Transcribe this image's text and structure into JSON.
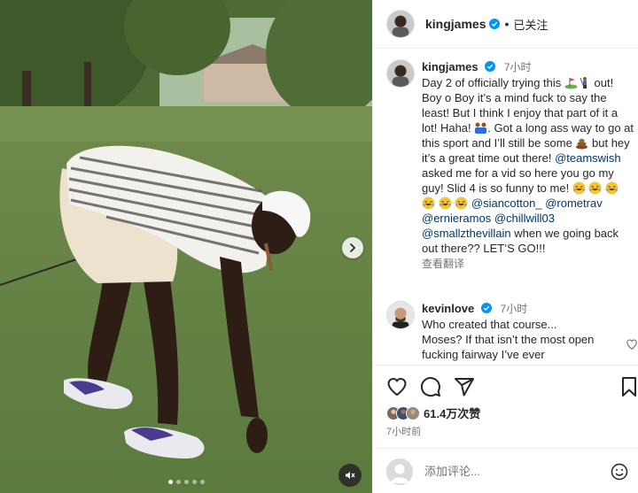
{
  "post": {
    "author": "kingjames",
    "follow_status": "已关注",
    "caption_time": "7小时",
    "caption_parts": {
      "p1": "Day 2 of officially trying this ",
      "p2": " out! Boy o Boy it’s a mind fuck to say the least! But I think I enjoy that part of it a lot! Haha! ",
      "p3": ". Got a long ass way to go at this sport and I’ll still be some ",
      "p4": " but hey it’s a great time out there! ",
      "m1": "@teamswish",
      "p5": " asked me for a vid so here you go my guy! Slid 4 is so funny to me! ",
      "m2": "@siancotton_",
      "m3": "@rometrav",
      "m4": "@ernieramos",
      "m5": "@chillwill03",
      "m6": "@smallzthevillain",
      "p6": " when we going back out there?? LET’S GO!!!"
    },
    "see_translation": "查看翻译"
  },
  "comment": {
    "user": "kevinlove",
    "time": "7小时",
    "text": "Who created that course... Moses? If that isn’t the most open fucking fairway I’ve ever"
  },
  "actions": {
    "likes": "61.4万次赞",
    "posted_ago": "7小时前"
  },
  "add_comment": {
    "placeholder": "添加评论..."
  },
  "colors": {
    "verified": "#0095f6",
    "mention": "#00376b",
    "secondary_text": "#737373"
  },
  "icons": {
    "next": "chevron-right-icon",
    "mute": "speaker-muted-icon",
    "like": "heart-icon",
    "comment": "comment-bubble-icon",
    "share": "paper-plane-icon",
    "save": "bookmark-icon",
    "emoji": "smiley-icon"
  },
  "carousel": {
    "slides": 5,
    "active": 1
  }
}
